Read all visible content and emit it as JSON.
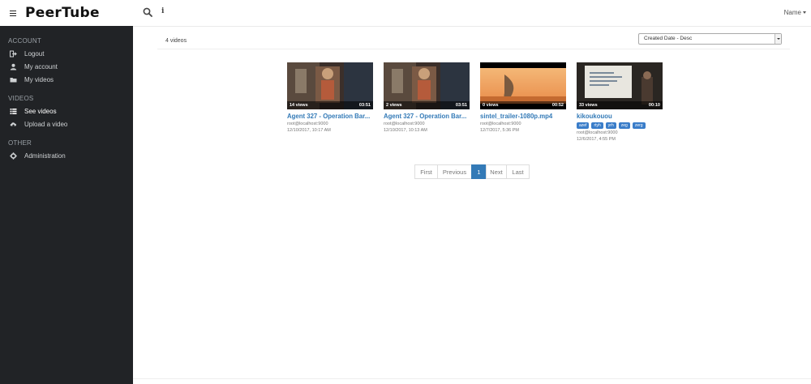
{
  "app": {
    "name": "PeerTube"
  },
  "header": {
    "user_name": "Name",
    "info_label": "i"
  },
  "sidebar": {
    "sections": [
      {
        "title": "ACCOUNT",
        "items": [
          {
            "label": "Logout",
            "icon": "logout-icon"
          },
          {
            "label": "My account",
            "icon": "user-icon"
          },
          {
            "label": "My videos",
            "icon": "folder-icon"
          }
        ]
      },
      {
        "title": "VIDEOS",
        "items": [
          {
            "label": "See videos",
            "icon": "list-icon",
            "active": true
          },
          {
            "label": "Upload a video",
            "icon": "cloud-upload-icon"
          }
        ]
      },
      {
        "title": "OTHER",
        "items": [
          {
            "label": "Administration",
            "icon": "gear-icon"
          }
        ]
      }
    ]
  },
  "main": {
    "videos_count": "4 videos",
    "sort": {
      "selected": "Created Date - Desc"
    },
    "videos": [
      {
        "title": "Agent 327 - Operation Bar...",
        "views": "14 views",
        "duration": "03:51",
        "author": "root@localhost:9000",
        "date": "12/10/2017, 10:17 AM",
        "tags": []
      },
      {
        "title": "Agent 327 - Operation Bar...",
        "views": "2 views",
        "duration": "03:51",
        "author": "root@localhost:9000",
        "date": "12/10/2017, 10:13 AM",
        "tags": []
      },
      {
        "title": "sintel_trailer-1080p.mp4",
        "views": "0 views",
        "duration": "00:52",
        "author": "root@localhost:9000",
        "date": "12/7/2017, 5:36 PM",
        "tags": []
      },
      {
        "title": "kikoukouou",
        "views": "33 views",
        "duration": "00:10",
        "author": "root@localhost:9000",
        "date": "12/6/2017, 4:55 PM",
        "tags": [
          "azef",
          "rtyh",
          "yrh",
          "zeg",
          "zerg"
        ]
      }
    ],
    "pagination": {
      "first": "First",
      "previous": "Previous",
      "current": "1",
      "next": "Next",
      "last": "Last"
    }
  },
  "colors": {
    "sidebar_bg": "#212326",
    "link": "#337ab7",
    "tag_bg": "#3a7dc9"
  }
}
